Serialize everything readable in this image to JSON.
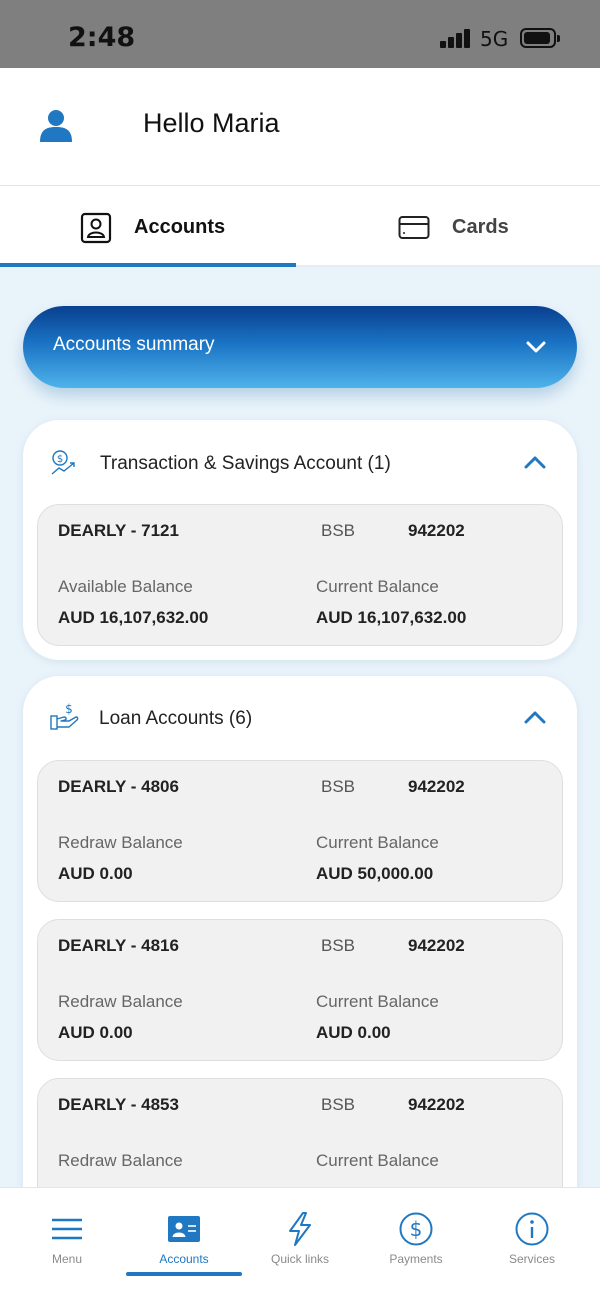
{
  "status_bar": {
    "time": "2:48",
    "network": "5G"
  },
  "header": {
    "greeting": "Hello Maria",
    "avatar_icon": "user-icon"
  },
  "tabs": [
    {
      "label": "Accounts",
      "icon": "id-badge-icon",
      "active": true
    },
    {
      "label": "Cards",
      "icon": "card-icon",
      "active": false
    }
  ],
  "summary": {
    "title": "Accounts summary",
    "icon": "chevron-down-icon"
  },
  "sections": {
    "savings": {
      "title": "Transaction & Savings Account (1)",
      "icon": "money-growth-icon",
      "accounts": [
        {
          "name": "DEARLY - 7121",
          "bsb_label": "BSB",
          "bsb": "942202",
          "left_label": "Available Balance",
          "left_value": "AUD 16,107,632.00",
          "right_label": "Current Balance",
          "right_value": "AUD 16,107,632.00"
        }
      ]
    },
    "loans": {
      "title": "Loan  Accounts (6)",
      "icon": "hand-dollar-icon",
      "accounts": [
        {
          "name": "DEARLY - 4806",
          "bsb_label": "BSB",
          "bsb": "942202",
          "left_label": "Redraw Balance",
          "left_value": "AUD 0.00",
          "right_label": "Current Balance",
          "right_value": "AUD 50,000.00"
        },
        {
          "name": "DEARLY - 4816",
          "bsb_label": "BSB",
          "bsb": "942202",
          "left_label": "Redraw Balance",
          "left_value": "AUD 0.00",
          "right_label": "Current Balance",
          "right_value": "AUD 0.00"
        },
        {
          "name": "DEARLY - 4853",
          "bsb_label": "BSB",
          "bsb": "942202",
          "left_label": "Redraw Balance",
          "left_value": "",
          "right_label": "Current Balance",
          "right_value": ""
        }
      ]
    }
  },
  "bottom_nav": [
    {
      "label": "Menu",
      "icon": "hamburger-icon"
    },
    {
      "label": "Accounts",
      "icon": "id-card-icon",
      "active": true
    },
    {
      "label": "Quick links",
      "icon": "lightning-icon"
    },
    {
      "label": "Payments",
      "icon": "dollar-circle-icon"
    },
    {
      "label": "Services",
      "icon": "info-icon"
    }
  ],
  "colors": {
    "accent": "#1f78c1",
    "summary_dark": "#0a3f8f",
    "summary_light": "#4fb3ea",
    "content_bg": "#e9f3fa"
  }
}
